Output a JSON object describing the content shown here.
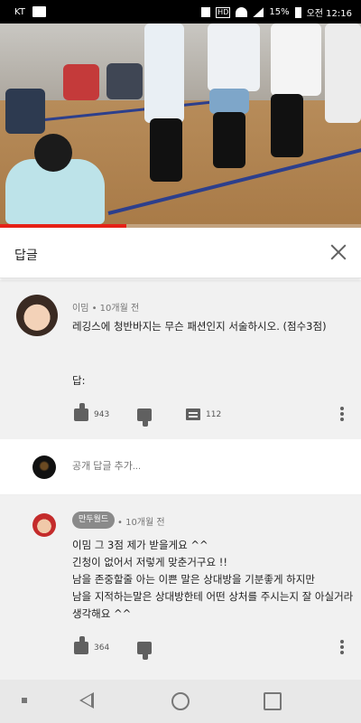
{
  "status_bar": {
    "carrier": "KT",
    "battery": "15%",
    "time": "오전 12:16",
    "icons": [
      "pulse-icon",
      "mute-icon",
      "hd-icon",
      "wifi-icon",
      "signal-icon",
      "battery-icon"
    ]
  },
  "video": {
    "progress": 0.35,
    "progress_color": "#e62117"
  },
  "panel": {
    "title": "답글",
    "close_icon": "close-icon"
  },
  "main_comment": {
    "author": "이밈",
    "time": "10개월 전",
    "text_line1": "레깅스에 청반바지는 무슨 패션인지 서술하시오. (점수3점)",
    "text_line2": "답:",
    "likes": "943",
    "replies": "112"
  },
  "add_reply": {
    "placeholder": "공개 답글 추가..."
  },
  "reply": {
    "author": "만두월드",
    "time": "10개월 전",
    "lines": [
      "이밈 그 3점 제가 받을게요 ^^",
      "긴청이 없어서 저렇게 맞춘거구요 !!",
      "남을 존중할줄 아는 이쁜 말은 상대방을 기분좋게 하지만",
      "남을 지적하는말은 상대방한테 어떤 상처를 주시는지 잘 아실거라",
      "생각해요 ^^"
    ],
    "likes": "364"
  },
  "nav": {
    "icons": [
      "recent-dot-icon",
      "back-icon",
      "home-icon",
      "overview-icon"
    ]
  }
}
